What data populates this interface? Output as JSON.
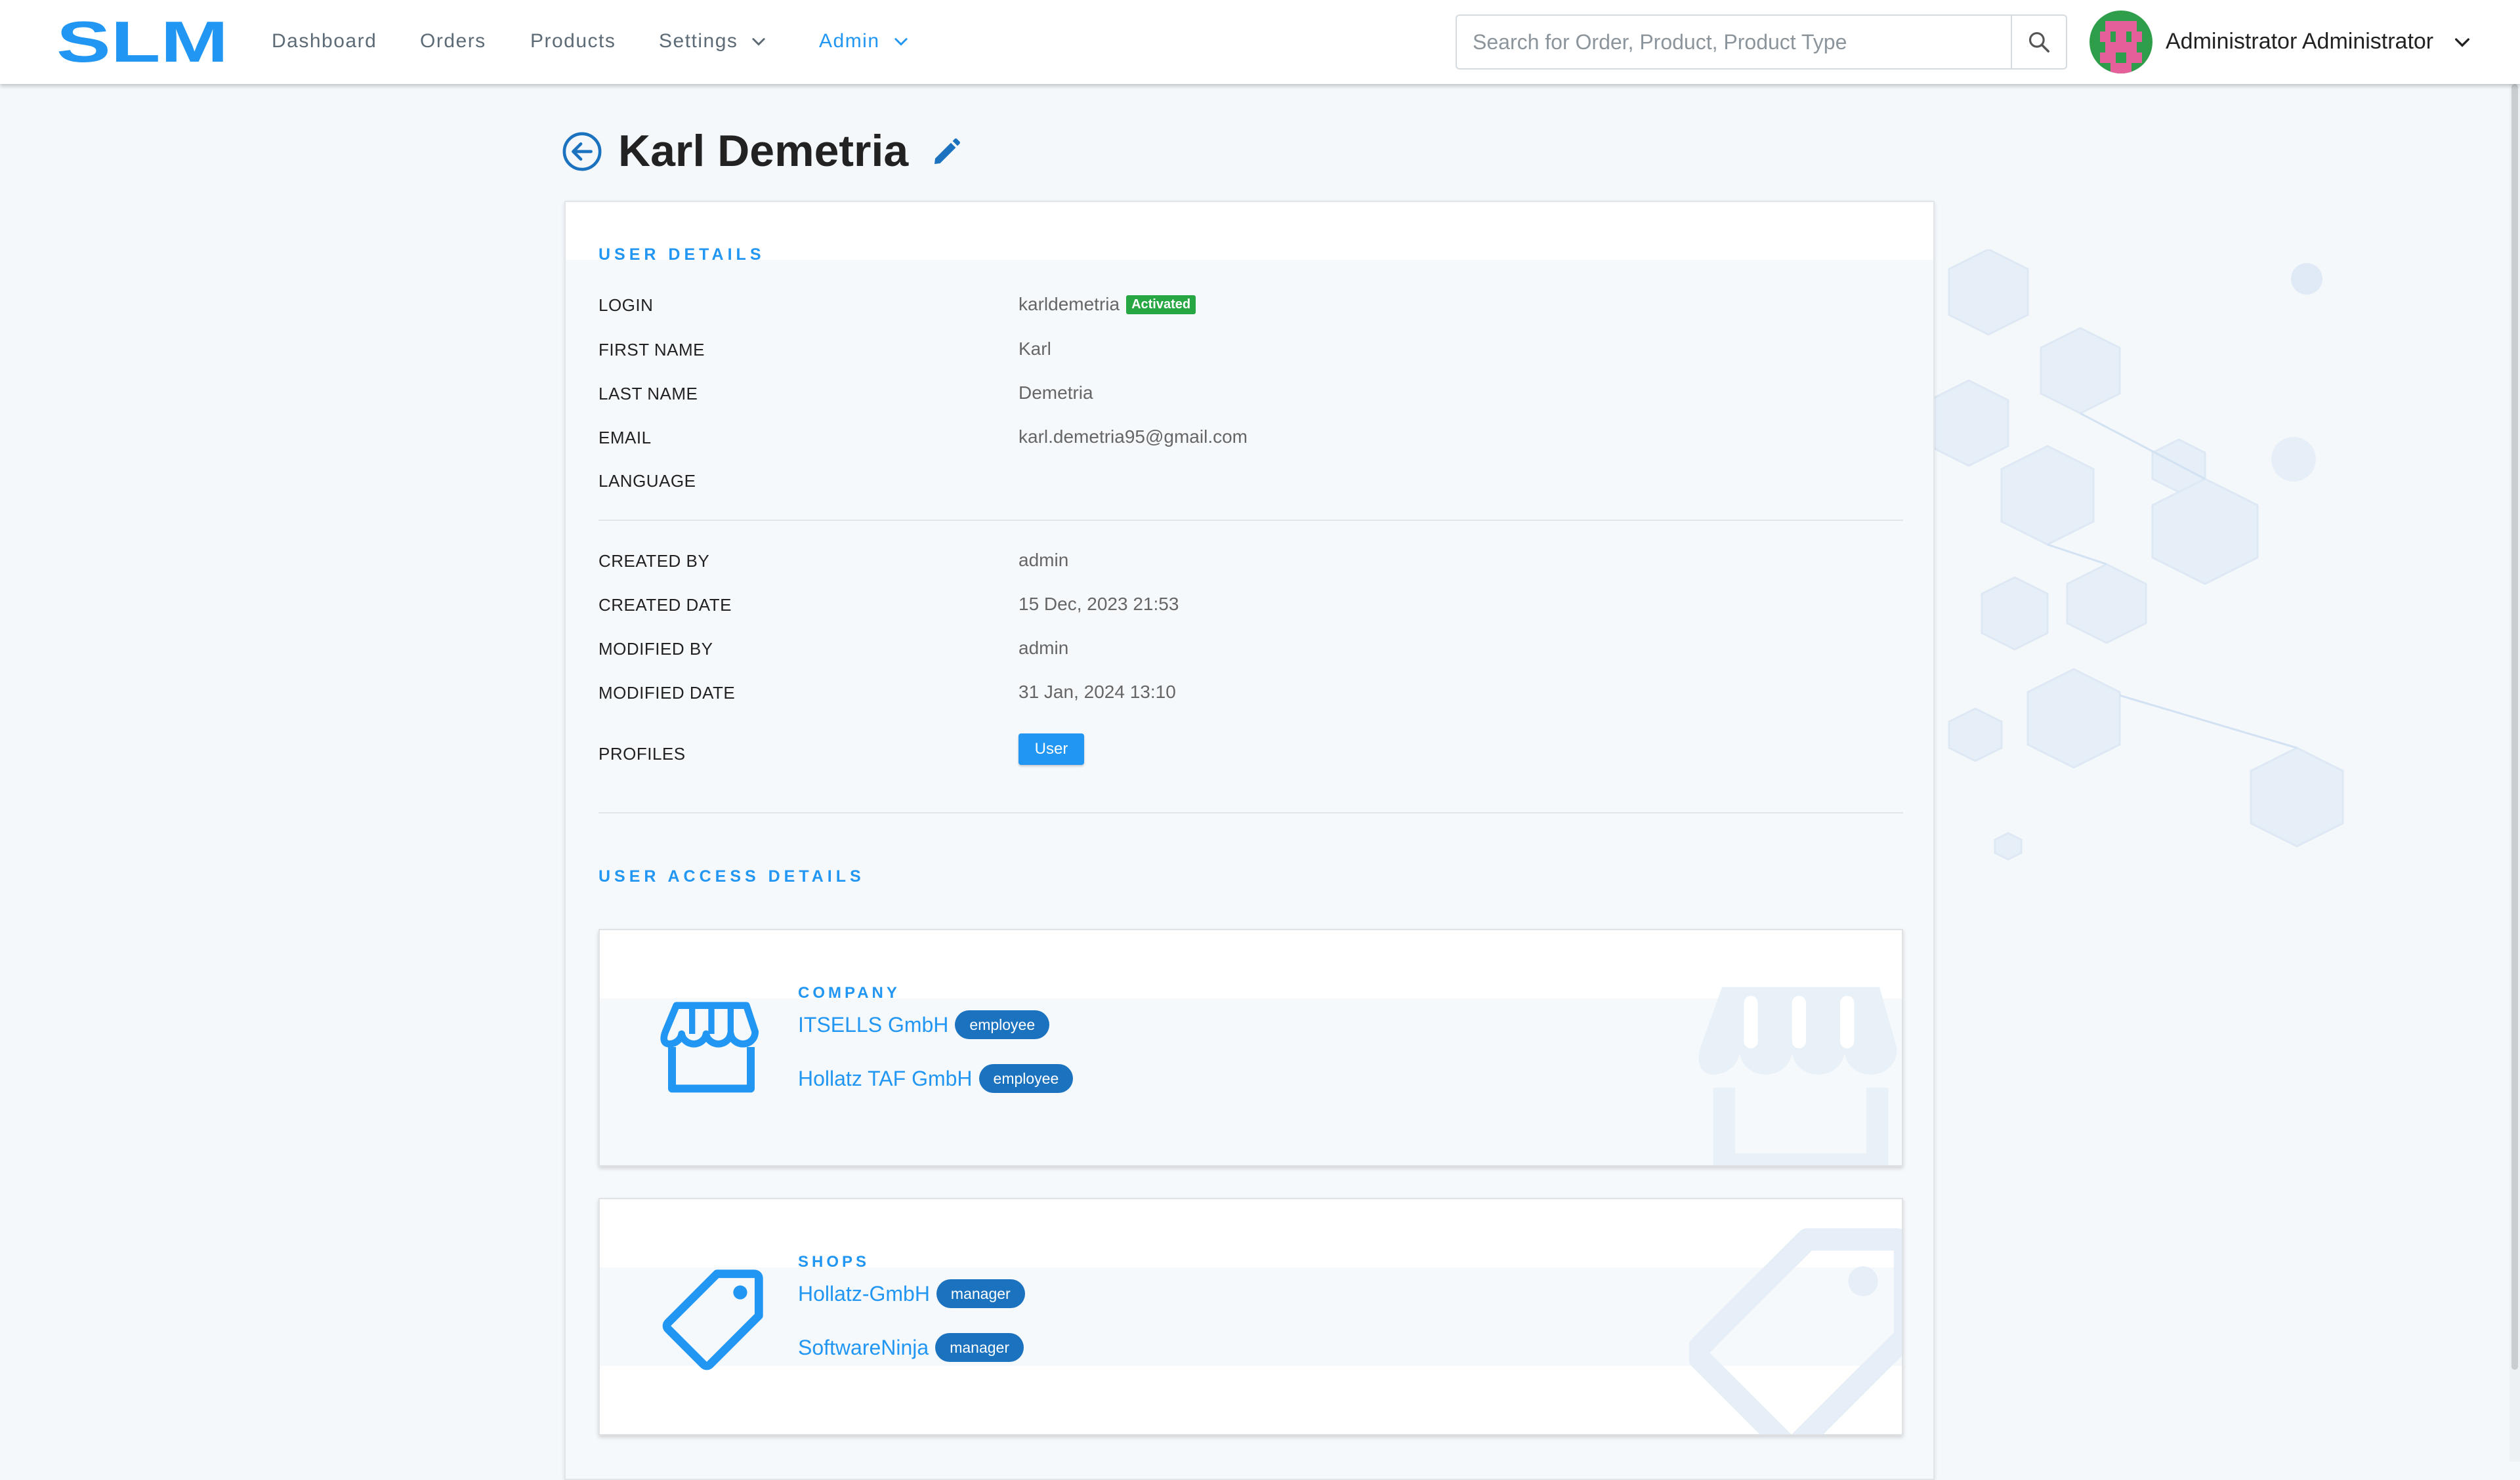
{
  "app": {
    "logo_text": "SLM",
    "brand_color": "#2196f3"
  },
  "nav": {
    "items": [
      {
        "label": "Dashboard"
      },
      {
        "label": "Orders"
      },
      {
        "label": "Products"
      },
      {
        "label": "Settings",
        "has_dropdown": true
      },
      {
        "label": "Admin",
        "has_dropdown": true,
        "active": true
      }
    ]
  },
  "search": {
    "placeholder": "Search for Order, Product, Product Type",
    "value": ""
  },
  "current_user": {
    "name": "Administrator Administrator"
  },
  "page": {
    "title": "Karl Demetria"
  },
  "user_details": {
    "section_title": "USER DETAILS",
    "login_label": "LOGIN",
    "login_value": "karldemetria",
    "login_status": "Activated",
    "first_name_label": "FIRST NAME",
    "first_name_value": "Karl",
    "last_name_label": "LAST NAME",
    "last_name_value": "Demetria",
    "email_label": "EMAIL",
    "email_value": "karl.demetria95@gmail.com",
    "language_label": "LANGUAGE",
    "language_value": "",
    "created_by_label": "CREATED BY",
    "created_by_value": "admin",
    "created_date_label": "CREATED DATE",
    "created_date_value": "15 Dec, 2023 21:53",
    "modified_by_label": "MODIFIED BY",
    "modified_by_value": "admin",
    "modified_date_label": "MODIFIED DATE",
    "modified_date_value": "31 Jan, 2024 13:10",
    "profiles_label": "PROFILES",
    "profiles": [
      "User"
    ]
  },
  "user_access": {
    "section_title": "USER ACCESS DETAILS",
    "company": {
      "title": "COMPANY",
      "entries": [
        {
          "name": "ITSELLS GmbH",
          "role": "employee"
        },
        {
          "name": "Hollatz TAF GmbH",
          "role": "employee"
        }
      ]
    },
    "shops": {
      "title": "SHOPS",
      "entries": [
        {
          "name": "Hollatz-GmbH",
          "role": "manager"
        },
        {
          "name": "SoftwareNinja",
          "role": "manager"
        }
      ]
    }
  }
}
